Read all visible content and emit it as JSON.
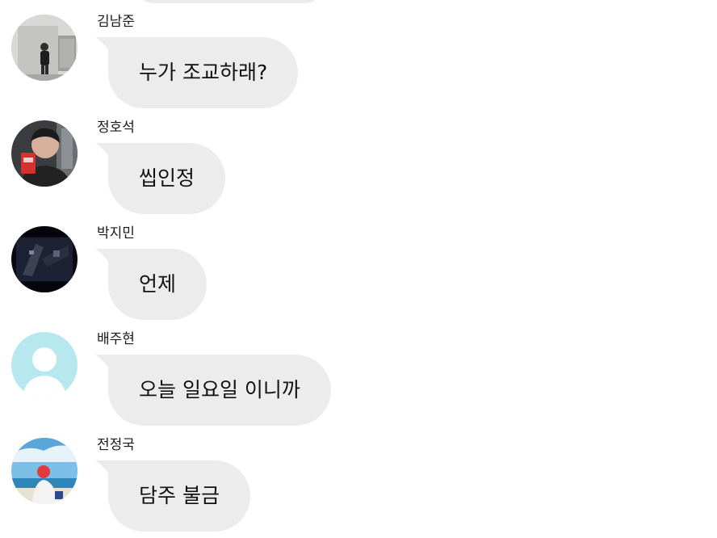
{
  "colors": {
    "bubble": "#ececec",
    "text": "#111111",
    "background": "#ffffff",
    "default_avatar_bg": "#b7e7ef"
  },
  "messages": [
    {
      "sender": "김남준",
      "text": "누가 조교하래?",
      "avatar": "photo-avatar-gray"
    },
    {
      "sender": "정호석",
      "text": "씹인정",
      "avatar": "photo-avatar-person"
    },
    {
      "sender": "박지민",
      "text": "언제",
      "avatar": "photo-avatar-dark"
    },
    {
      "sender": "배주현",
      "text": "오늘 일요일 이니까",
      "avatar": "default-user-icon"
    },
    {
      "sender": "전정국",
      "text": "담주 불금",
      "avatar": "photo-avatar-sky"
    }
  ]
}
